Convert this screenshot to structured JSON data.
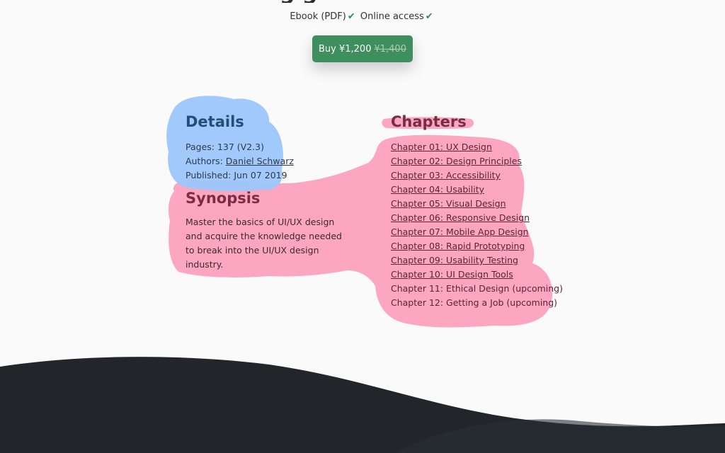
{
  "header": {
    "title_fragment": "g g",
    "formats": [
      "Ebook (PDF)",
      "Online access"
    ],
    "check_icon": "✔",
    "buy_label": "Buy ¥1,200",
    "old_price": "¥1,400"
  },
  "colors": {
    "details_blob": "#9cc6fb",
    "pink_blob": "#fca6c2",
    "buy_button": "#3e8e5e",
    "footer": "#22262b"
  },
  "details": {
    "title": "Details",
    "pages": "Pages: 137 (V2.3)",
    "authors_label": "Authors:",
    "author_name": "Daniel Schwarz",
    "published": "Published: Jun 07 2019"
  },
  "synopsis": {
    "title": "Synopsis",
    "text": "Master the basics of UI/UX design and acquire the knowledge needed to break into the UI/UX design industry."
  },
  "chapters": {
    "title": "Chapters",
    "items": [
      "Chapter 01: UX Design",
      "Chapter 02: Design Principles",
      "Chapter 03: Accessibility",
      "Chapter 04: Usability",
      "Chapter 05: Visual Design",
      "Chapter 06: Responsive Design",
      "Chapter 07: Mobile App Design",
      "Chapter 08: Rapid Prototyping",
      "Chapter 09: Usability Testing",
      "Chapter 10: UI Design Tools",
      "Chapter 11: Ethical Design (upcoming)",
      "Chapter 12: Getting a Job (upcoming)"
    ]
  }
}
